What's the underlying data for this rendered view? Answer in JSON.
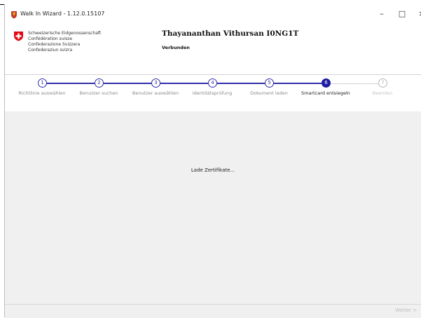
{
  "window": {
    "title": "Walk In Wizard - 1.12.0.15107",
    "minimize": "–",
    "maximize": "□",
    "close": "×"
  },
  "header": {
    "confederation_lines": [
      "Schweizerische Eidgenossenschaft",
      "Confédération suisse",
      "Confederazione Svizzera",
      "Confederaziun svizra"
    ],
    "user_name": "Thayananthan Vithursan I0NG1T",
    "status": "Verbunden"
  },
  "steps": [
    {
      "number": "1",
      "label": "Richtlinie auswählen",
      "state": "done"
    },
    {
      "number": "2",
      "label": "Benutzer suchen",
      "state": "done"
    },
    {
      "number": "3",
      "label": "Benutzer auswählen",
      "state": "done"
    },
    {
      "number": "4",
      "label": "Identitätsprüfung",
      "state": "done"
    },
    {
      "number": "5",
      "label": "Dokument laden",
      "state": "done"
    },
    {
      "number": "6",
      "label": "Smartcard entsiegeln",
      "state": "active"
    },
    {
      "number": "7",
      "label": "Beenden",
      "state": "disabled"
    }
  ],
  "content": {
    "loading_text": "Lade Zertifikate..."
  },
  "footer": {
    "next_label": "Weiter >"
  },
  "colors": {
    "accent": "#2e2fa8",
    "active_step": "#1d1da3",
    "swiss_red": "#e30613",
    "content_bg": "#f0f0f0"
  }
}
